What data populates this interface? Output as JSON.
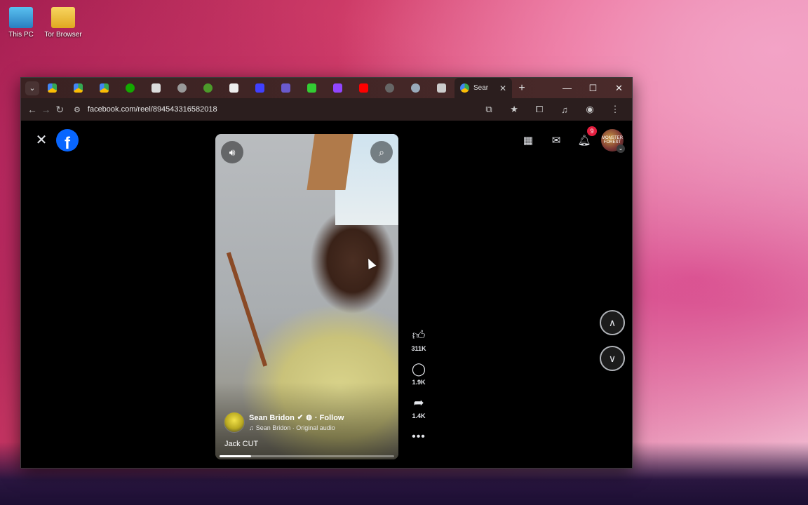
{
  "desktop": {
    "icons": [
      {
        "label": "This PC",
        "color": "#3aa0d8"
      },
      {
        "label": "Tor Browser",
        "color": "#f0c23a"
      }
    ]
  },
  "browser": {
    "tabs": {
      "list_button": "⌄",
      "favicons": [
        "#34a853",
        "#fbbc04",
        "#4285f4",
        "#34a853",
        "#aaaaaa",
        "#c0c0c0",
        "#4c9a2a",
        "#dddddd",
        "#6060ff",
        "#6a5acd",
        "#33cc33",
        "#9146ff",
        "#ff0000",
        "#cccccc",
        "#9ab"
      ],
      "active_label": "Sear",
      "new_tab": "+"
    },
    "window_controls": {
      "minimize": "—",
      "maximize": "☐",
      "close": "✕"
    },
    "address": {
      "back": "←",
      "forward": "→",
      "reload": "↻",
      "url": "facebook.com/reel/894543316582018"
    }
  },
  "facebook": {
    "close": "✕",
    "logo": "f",
    "header": {
      "notification_count": "9",
      "avatar_text": "MONSTER FOREST"
    },
    "reel": {
      "author": "Sean Bridon",
      "follow": "· Follow",
      "audio": "Sean Bridon · Original audio",
      "caption": "Jack CUT",
      "progress": 0.18
    },
    "actions": {
      "likes": "311K",
      "comments": "1.9K",
      "shares": "1.4K",
      "more": "•••"
    }
  }
}
